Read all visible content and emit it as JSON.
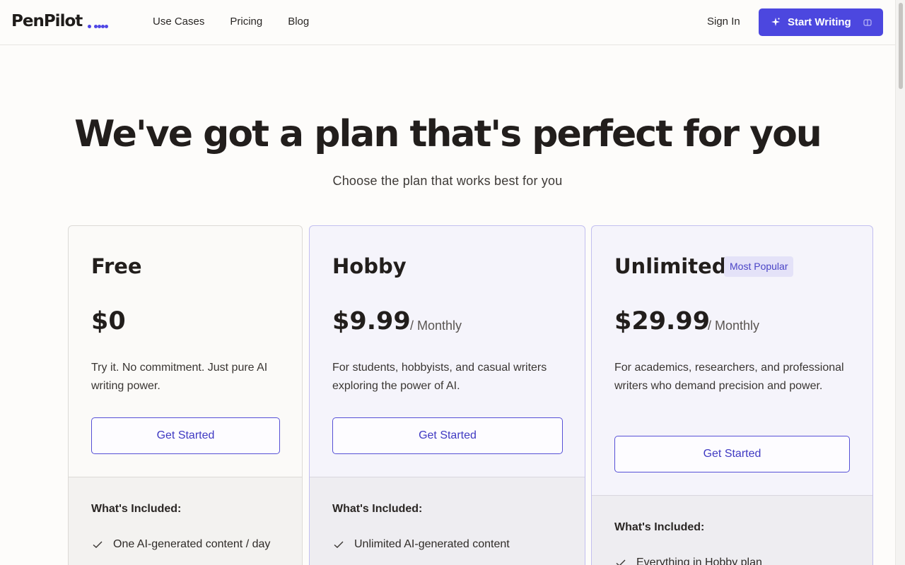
{
  "brand": {
    "name": "PenPilot"
  },
  "nav": {
    "items": [
      "Use Cases",
      "Pricing",
      "Blog"
    ]
  },
  "header": {
    "sign_in": "Sign In",
    "cta": "Start Writing"
  },
  "hero": {
    "title": "We've got a plan that's perfect for you",
    "subtitle": "Choose the plan that works best for you"
  },
  "plans": [
    {
      "name": "Free",
      "badge": "",
      "price": "$0",
      "period": "",
      "description": "Try it. No commitment. Just pure AI writing power.",
      "button": "Get Started",
      "included_title": "What's Included:",
      "features": [
        "One AI-generated content / day"
      ]
    },
    {
      "name": "Hobby",
      "badge": "",
      "price": "$9.99",
      "period": "/ Monthly",
      "description": "For students, hobbyists, and casual writers exploring the power of AI.",
      "button": "Get Started",
      "included_title": "What's Included:",
      "features": [
        "Unlimited AI-generated content"
      ]
    },
    {
      "name": "Unlimited",
      "badge": "Most Popular",
      "price": "$29.99",
      "period": "/ Monthly",
      "description": "For academics, researchers, and professional writers who demand precision and power.",
      "button": "Get Started",
      "included_title": "What's Included:",
      "features": [
        "Everything in Hobby plan"
      ]
    }
  ],
  "colors": {
    "accent": "#4c47df",
    "background": "#fdfcfa",
    "badge_bg": "#e4e2f8"
  },
  "icons": {
    "cta": "sparkle-icon",
    "cta_trailing": "chip-icon",
    "feature": "check-icon"
  }
}
